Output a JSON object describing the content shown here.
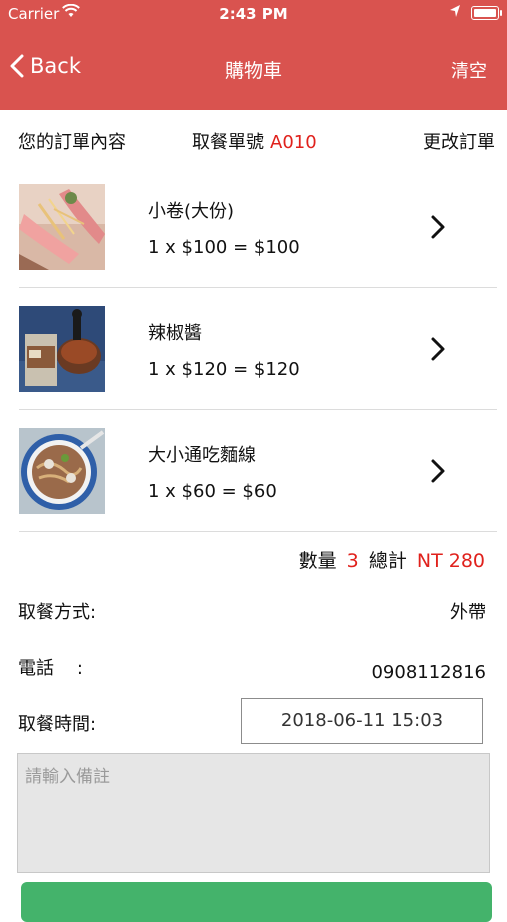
{
  "status_bar": {
    "carrier": "Carrier",
    "time": "2:43 PM"
  },
  "nav": {
    "back_label": "Back",
    "title": "購物車",
    "clear_label": "清空"
  },
  "order_header": {
    "your_order_label": "您的訂單內容",
    "pickup_number_label": "取餐單號",
    "pickup_number": "A010",
    "modify_label": "更改訂單"
  },
  "items": [
    {
      "name": "小卷(大份)",
      "calc": "1 x $100 = $100",
      "image": "squid-photo",
      "qty": 1,
      "price": 100,
      "subtotal": 100
    },
    {
      "name": "辣椒醬",
      "calc": "1 x $120 = $120",
      "image": "chili-sauce-photo",
      "qty": 1,
      "price": 120,
      "subtotal": 120
    },
    {
      "name": "大小通吃麵線",
      "calc": "1 x $60 = $60",
      "image": "noodle-bowl-photo",
      "qty": 1,
      "price": 60,
      "subtotal": 60
    }
  ],
  "summary": {
    "quantity_label": "數量",
    "quantity": "3",
    "total_label": "總計",
    "total": "NT 280"
  },
  "details": {
    "pickup_method_label": "取餐方式:",
    "pickup_method": "外帶",
    "phone_label": "電話    :",
    "phone": "0908112816",
    "pickup_time_label": "取餐時間:",
    "pickup_time": "2018-06-11 15:03"
  },
  "note": {
    "placeholder": "請輸入備註"
  },
  "colors": {
    "nav_bg": "#d9534f",
    "accent_red": "#e0211c",
    "submit_green": "#44b36b"
  }
}
